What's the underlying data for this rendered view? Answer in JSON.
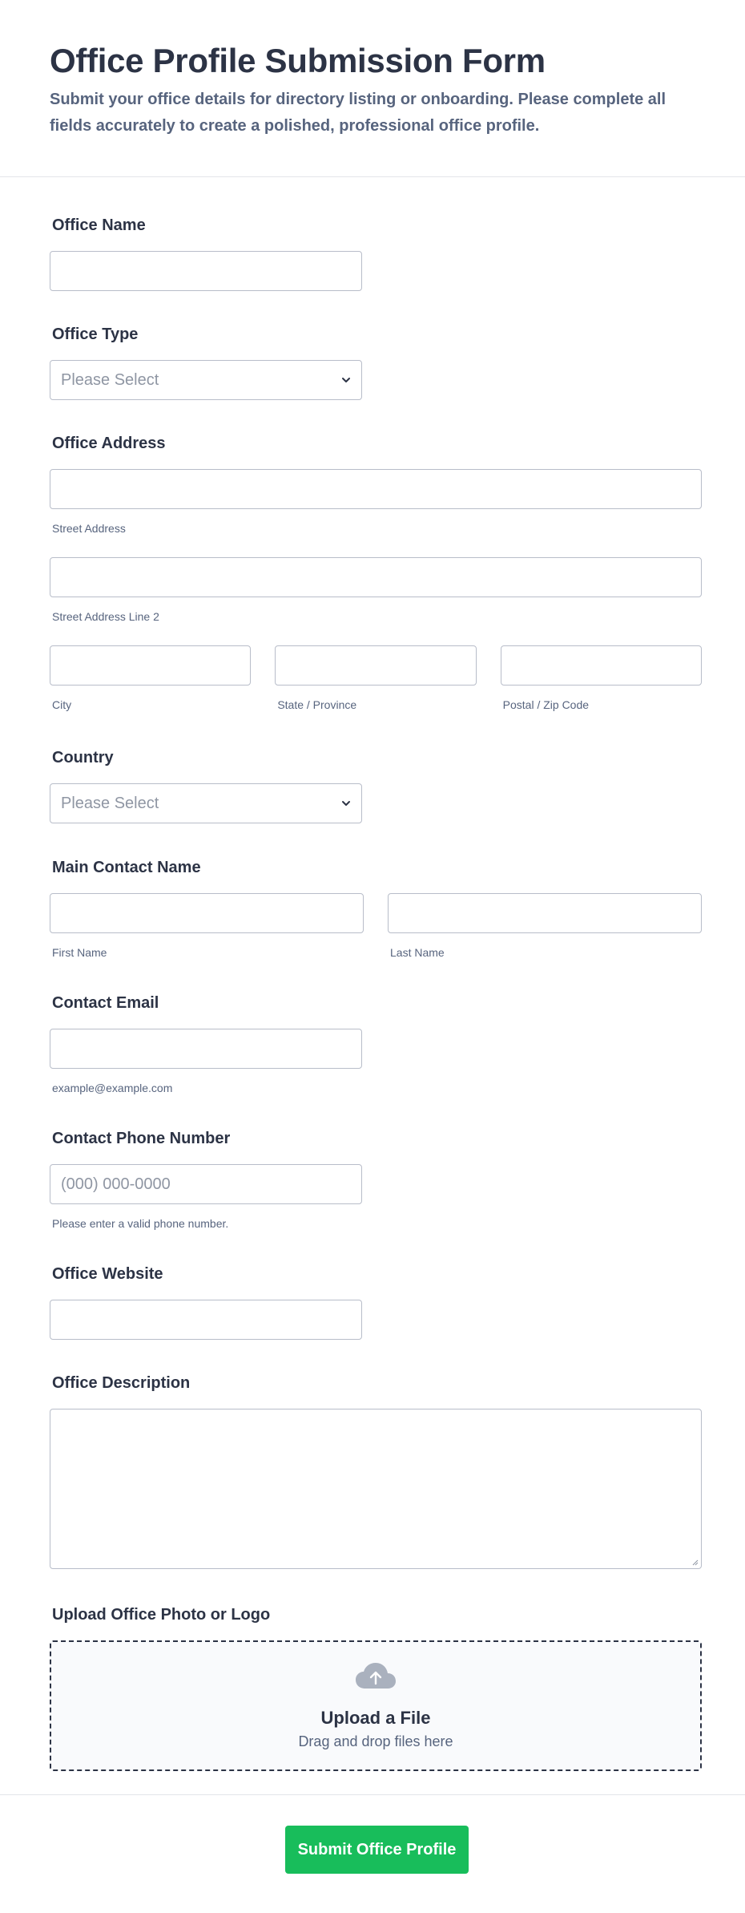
{
  "header": {
    "title": "Office Profile Submission Form",
    "description": "Submit your office details for directory listing or onboarding. Please complete all fields accurately to create a polished, professional office profile."
  },
  "office_name": {
    "label": "Office Name",
    "value": ""
  },
  "office_type": {
    "label": "Office Type",
    "placeholder": "Please Select"
  },
  "office_address": {
    "label": "Office Address",
    "street": "Street Address",
    "street2": "Street Address Line 2",
    "city": "City",
    "state": "State / Province",
    "postal": "Postal / Zip Code"
  },
  "country": {
    "label": "Country",
    "placeholder": "Please Select"
  },
  "contact_name": {
    "label": "Main Contact Name",
    "first": "First Name",
    "last": "Last Name"
  },
  "contact_email": {
    "label": "Contact Email",
    "hint": "example@example.com"
  },
  "contact_phone": {
    "label": "Contact Phone Number",
    "placeholder": "(000) 000-0000",
    "hint": "Please enter a valid phone number."
  },
  "office_website": {
    "label": "Office Website"
  },
  "office_description": {
    "label": "Office Description"
  },
  "upload": {
    "label": "Upload Office Photo or Logo",
    "title": "Upload a File",
    "desc": "Drag and drop files here",
    "icon": "cloud-upload-icon"
  },
  "submit": {
    "label": "Submit Office Profile"
  },
  "colors": {
    "accent": "#18bd5b",
    "text": "#2c3345",
    "muted": "#57647e",
    "border": "#b8bdc9"
  }
}
